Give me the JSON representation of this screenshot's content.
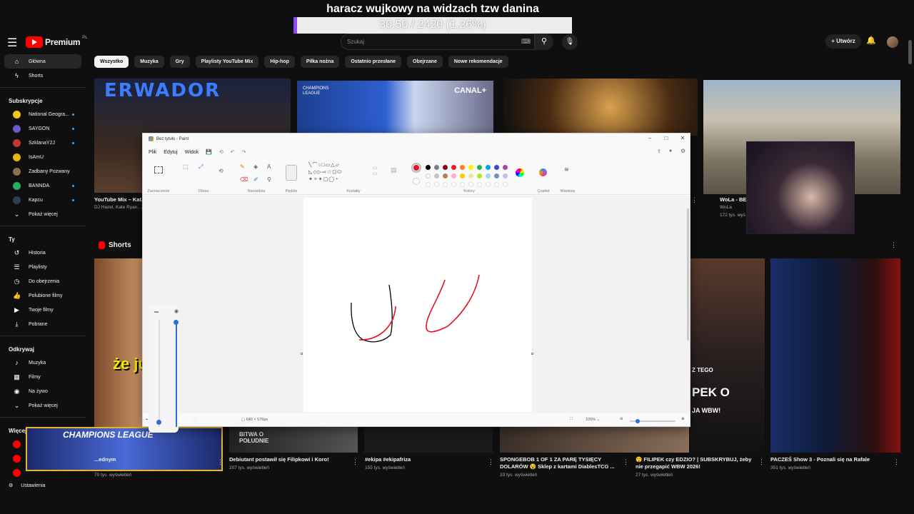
{
  "overlay": {
    "goal_title": "haracz wujkowy na widzach tzw danina",
    "goal_progress": "30.50 / 2420 (1.26%)",
    "goal_fraction": 0.0126,
    "goal_color": "#9146ff"
  },
  "header": {
    "logo_text": "Premium",
    "logo_region": "PL",
    "search_placeholder": "Szukaj",
    "create_label": "Utwórz"
  },
  "chips": [
    "Wszystko",
    "Muzyka",
    "Gry",
    "Playlisty YouTube Mix",
    "Hip-hop",
    "Piłka nożna",
    "Ostatnio przesłane",
    "Obejrzane",
    "Nowe rekomendacje"
  ],
  "sidebar": {
    "main": [
      {
        "label": "Główna",
        "icon": "home-icon"
      },
      {
        "label": "Shorts",
        "icon": "shorts-icon"
      }
    ],
    "subs_heading": "Subskrypcje",
    "subs": [
      {
        "label": "National Geogra...",
        "color": "#f5c518"
      },
      {
        "label": "SAYGON",
        "color": "#6a5acd"
      },
      {
        "label": "SzklanaY2J",
        "color": "#c0392b"
      },
      {
        "label": "IsAmU",
        "color": "#e6b800"
      },
      {
        "label": "Zadbany Pozwany",
        "color": "#8e6e53"
      },
      {
        "label": "BANNDA",
        "color": "#27ae60"
      },
      {
        "label": "Kapcu",
        "color": "#2c3e50"
      }
    ],
    "show_more": "Pokaż więcej",
    "you_heading": "Ty",
    "you": [
      {
        "label": "Historia",
        "icon": "history-icon"
      },
      {
        "label": "Playlisty",
        "icon": "playlist-icon"
      },
      {
        "label": "Do obejrzenia",
        "icon": "clock-icon"
      },
      {
        "label": "Polubione filmy",
        "icon": "thumbs-up-icon"
      },
      {
        "label": "Twoje filmy",
        "icon": "video-icon"
      },
      {
        "label": "Pobrane",
        "icon": "download-icon"
      }
    ],
    "explore_heading": "Odkrywaj",
    "explore": [
      {
        "label": "Muzyka",
        "icon": "music-icon"
      },
      {
        "label": "Filmy",
        "icon": "film-icon"
      },
      {
        "label": "Na żywo",
        "icon": "live-icon"
      }
    ],
    "show_more_2": "Pokaż więcej",
    "more_yt_heading": "Więcej z YouTube",
    "settings": "Ustawienia"
  },
  "videos": [
    {
      "title": "YouTube Mix – Kat...",
      "channel": "DJ Hazel, Kate Ryan, ..."
    },
    {
      "title": "WoLa - BE",
      "channel": "WoLa",
      "views": "172 tys. wyś"
    }
  ],
  "thumb_texts": {
    "v1": "ERWADOR",
    "v2_badge": "CANAL+",
    "v2_league": "CHAMPIONS LEAGUE",
    "s1_caption": "że ju",
    "s2_caption": "CHAMPIONS LEAGUE",
    "s2_sub": "BITWA O POŁUDNIE",
    "s6_caption1": "Z TEGO",
    "s6_caption2": "PEK O",
    "s6_caption3": "JA WBW!"
  },
  "shorts_heading": "Shorts",
  "shorts": [
    {
      "title": "...ednym",
      "views": "70 tys. wyświetleń"
    },
    {
      "title": "Debiutant postawił się Filipkowi i Koro!",
      "views": "207 tys. wyświetleń"
    },
    {
      "title": "#ekipa #ekipafriza",
      "views": "155 tys. wyświetleń"
    },
    {
      "title": "SPONGEBOB 1 OF 1 ZA PARĘ TYSIĘCY DOLARÓW 😵 Sklep z kartami DiablesTCG ...",
      "views": "33 tys. wyświetleń"
    },
    {
      "title": "😲 FILIPEK czy EDZIO? | SUBSKRYBUJ, żeby nie przegapić WBW 2026!",
      "views": "27 tys. wyświetleń"
    },
    {
      "title": "PACZEŚ Show 3 - Poznali się na Rafale",
      "views": "351 tys. wyświetleń"
    }
  ],
  "paint": {
    "title": "Bez tytułu - Paint",
    "menu": [
      "Plik",
      "Edytuj",
      "Widok"
    ],
    "groups": [
      "Zaznaczenie",
      "Obraz",
      "Narzędzia",
      "Pędzle",
      "Kształty",
      "Kolory",
      "Copilot",
      "Warstwy"
    ],
    "canvas_size": "640 × 576px",
    "zoom": "100%",
    "active_color": "#e81123",
    "colors": [
      "#000000",
      "#7f7f7f",
      "#880015",
      "#ed1c24",
      "#ff7f27",
      "#fff200",
      "#22b14c",
      "#00a2e8",
      "#3f48cc",
      "#a349a4",
      "#ffffff",
      "#c3c3c3",
      "#b97a57",
      "#ffaec9",
      "#ffc90e",
      "#efe4b0",
      "#b5e61d",
      "#99d9ea",
      "#7092be",
      "#c8bfe7"
    ]
  }
}
